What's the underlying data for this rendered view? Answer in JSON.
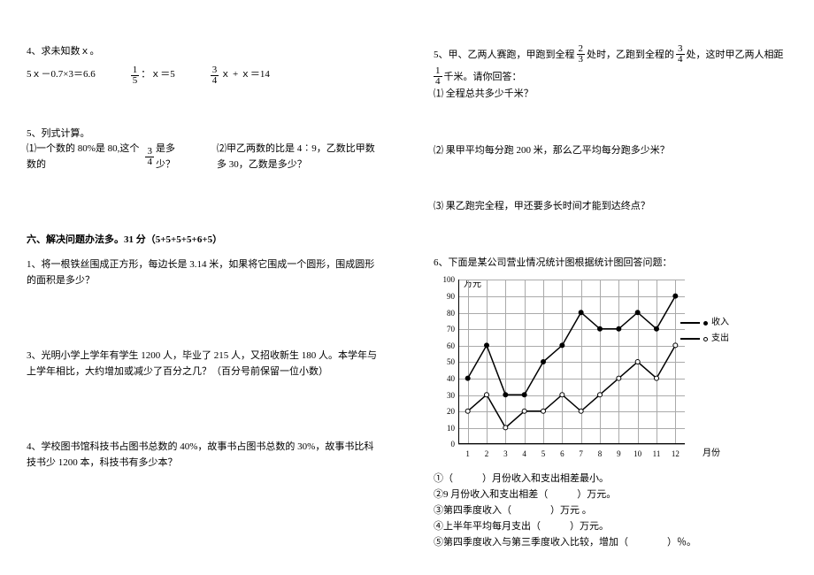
{
  "left": {
    "q4_title": "4、求未知数ｘ。",
    "q4_eq1_a": "5ｘ－0.7×3＝6.6",
    "q4_eq2_pre": "：ｘ＝5",
    "q4_eq3_post": "ｘ + ｘ＝14",
    "q5_title": "5、列式计算。",
    "q5_1_pre": "⑴一个数的 80%是 80,这个数的",
    "q5_1_post": "是多少？",
    "q5_2": "⑵甲乙两数的比是 4︰9，乙数比甲数多 30，乙数是多少？",
    "sec6_title": "六、解决问题办法多。31 分（5+5+5+5+6+5）",
    "q1": "1、将一根铁丝围成正方形，每边长是 3.14 米，如果将它围成一个圆形，围成圆形的面积是多少？",
    "q3": "3、光明小学上学年有学生 1200 人，毕业了 215 人，又招收新生 180 人。本学年与上学年相比，大约增加或减少了百分之几？（百分号前保留一位小数）",
    "q4b": "4、学校图书馆科技书占图书总数的 40%，故事书占图书总数的 30%，故事书比科技书少 1200 本，科技书有多少本？"
  },
  "right": {
    "q5r_pre1": "5、甲、乙两人赛跑，甲跑到全程",
    "q5r_mid1": "处时，乙跑到全程的",
    "q5r_mid2": "处，这时甲乙两人相距",
    "q5r_post": "千米。请你回答：",
    "q5r_1": "⑴ 全程总共多少千米？",
    "q5r_2": "⑵ 果甲平均每分跑 200 米，那么乙平均每分跑多少米？",
    "q5r_3": "⑶ 果乙跑完全程，甲还要多长时间才能到达终点？",
    "q6_title": "6、下面是某公司营业情况统计图根据统计图回答问题：",
    "q6_1": "①（　　　）月份收入和支出相差最小。",
    "q6_2": "②9 月份收入和支出相差（　　　）万元。",
    "q6_3": "③第四季度收入（　　　　）万元 。",
    "q6_4": "④上半年平均每月支出（　　　）万元。",
    "q6_5": "⑤第四季度收入与第三季度收入比较，增加（　　　　）％。",
    "legend_income": "收入",
    "legend_expense": "支出",
    "y_unit": "万元",
    "x_unit": "月份"
  },
  "fractions": {
    "one_fifth_n": "1",
    "one_fifth_d": "5",
    "three_four_n": "3",
    "three_four_d": "4",
    "two_three_n": "2",
    "two_three_d": "3",
    "one_four_n": "1",
    "one_four_d": "4"
  },
  "chart_data": {
    "type": "line",
    "xlabel": "月份",
    "ylabel": "万元",
    "ylim": [
      0,
      100
    ],
    "y_ticks": [
      0,
      10,
      20,
      30,
      40,
      50,
      60,
      70,
      80,
      90,
      100
    ],
    "categories": [
      1,
      2,
      3,
      4,
      5,
      6,
      7,
      8,
      9,
      10,
      11,
      12
    ],
    "series": [
      {
        "name": "收入",
        "values": [
          40,
          60,
          30,
          30,
          50,
          60,
          80,
          70,
          70,
          80,
          70,
          90
        ]
      },
      {
        "name": "支出",
        "values": [
          20,
          30,
          10,
          20,
          20,
          30,
          20,
          30,
          40,
          50,
          40,
          60
        ]
      }
    ],
    "legend_position": "right",
    "grid": true
  }
}
